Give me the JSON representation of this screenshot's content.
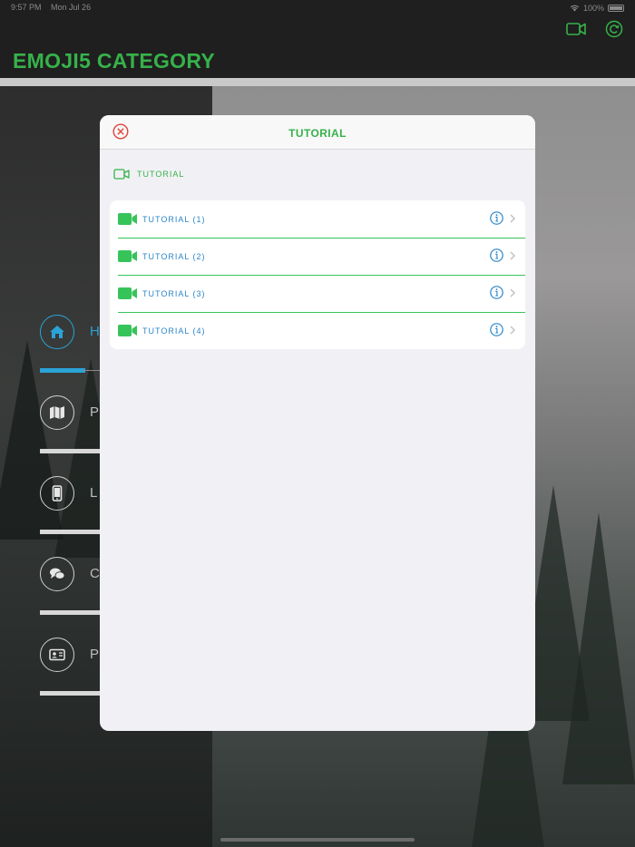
{
  "status_bar": {
    "time": "9:57 PM",
    "date": "Mon Jul 26",
    "battery": "100%"
  },
  "app": {
    "title": "EMOJI5 CATEGORY"
  },
  "menu": {
    "items": [
      {
        "letter": "H",
        "icon": "home-icon",
        "active": true
      },
      {
        "letter": "P",
        "icon": "map-icon",
        "active": false
      },
      {
        "letter": "L",
        "icon": "phone-icon",
        "active": false
      },
      {
        "letter": "C",
        "icon": "chat-icon",
        "active": false
      },
      {
        "letter": "P",
        "icon": "id-card-icon",
        "active": false
      }
    ]
  },
  "modal": {
    "title": "TUTORIAL",
    "section_label": "TUTORIAL",
    "items": [
      {
        "label": "TUTORIAL (1)"
      },
      {
        "label": "TUTORIAL (2)"
      },
      {
        "label": "TUTORIAL (3)"
      },
      {
        "label": "TUTORIAL (4)"
      }
    ]
  },
  "colors": {
    "accent_green": "#36b24a",
    "link_blue": "#2a86c8",
    "menu_blue": "#2aa3d6",
    "close_red": "#e0443a"
  }
}
